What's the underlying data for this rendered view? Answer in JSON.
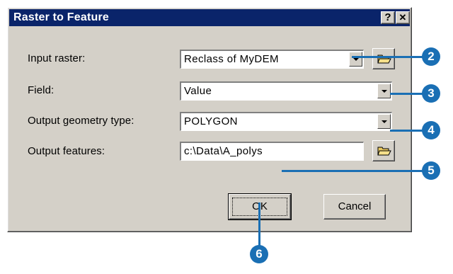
{
  "dialog": {
    "title": "Raster to Feature",
    "help_button": "?",
    "close_button": "✕"
  },
  "fields": {
    "input_raster": {
      "label": "Input raster:",
      "value": "Reclass of MyDEM"
    },
    "field": {
      "label": "Field:",
      "value": "Value"
    },
    "geometry_type": {
      "label": "Output geometry type:",
      "value": "POLYGON"
    },
    "output_features": {
      "label": "Output features:",
      "value": "c:\\Data\\A_polys"
    }
  },
  "buttons": {
    "ok": "OK",
    "cancel": "Cancel"
  },
  "callouts": [
    "2",
    "3",
    "4",
    "5",
    "6"
  ],
  "colors": {
    "titlebar": "#0a246a",
    "callout": "#1a6fb4",
    "dialog": "#d4d0c8"
  }
}
